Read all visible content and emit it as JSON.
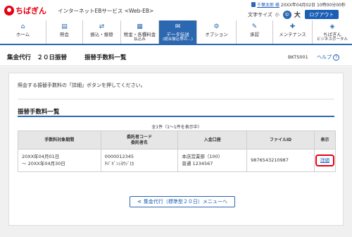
{
  "header": {
    "logo_text": "ちばぎん",
    "service_name": "インターネットEBサービス <Web-EB>",
    "user_name": "千葉太郎 様",
    "login_time": "20XX年04月02日 10時00分00秒",
    "font_size_label": "文字サイズ",
    "font_small": "小",
    "font_mid": "中",
    "font_large": "大",
    "logout_label": "ログアウト"
  },
  "nav": {
    "items": [
      {
        "label": "ホーム",
        "sub": "",
        "icon": "home-icon",
        "glyph": "⌂"
      },
      {
        "label": "照会",
        "sub": "",
        "icon": "document-icon",
        "glyph": "▤"
      },
      {
        "label": "振込・振替",
        "sub": "",
        "icon": "transfer-icon",
        "glyph": "⇄"
      },
      {
        "label": "税金・各種料金",
        "sub": "払込み",
        "icon": "tax-icon",
        "glyph": "▦"
      },
      {
        "label": "データ伝送",
        "sub": "(総合振込等の…)",
        "icon": "data-transfer-icon",
        "glyph": "✉"
      },
      {
        "label": "オプション",
        "sub": "",
        "icon": "gear-icon",
        "glyph": "⚙"
      },
      {
        "label": "承認",
        "sub": "",
        "icon": "approval-icon",
        "glyph": "✎"
      },
      {
        "label": "メンテナンス",
        "sub": "",
        "icon": "wrench-icon",
        "glyph": "✚"
      },
      {
        "label": "ちばぎん",
        "sub": "ビジネスポータル",
        "icon": "portal-icon",
        "glyph": "◈"
      }
    ]
  },
  "title": {
    "main": "集金代行　２０日振替",
    "sub": "振替手数料一覧",
    "screen_id": "BKTS001",
    "help": "ヘルプ",
    "help_glyph": "?"
  },
  "guide_text": "照会する振替手数料の「詳細」ボタンを押してください。",
  "section_title": "振替手数料一覧",
  "count_text": "全1件（1～1件を表示中）",
  "table": {
    "headers": [
      "手数料対象期間",
      "委託者コード\n委託者名",
      "入金口座",
      "ファイルID",
      "表示"
    ],
    "rows": [
      {
        "period_from": "20XX年04月01日",
        "period_to": "～ 20XX年04月30日",
        "code": "0000012345",
        "name": "ﾁﾊﾞｷﾞﾝｼﾖｳｼﾞ(ｶ",
        "branch": "本店営業部（100）",
        "account": "普通 1234567",
        "file_id": "9876543210987",
        "detail": "詳細"
      }
    ]
  },
  "back_button": "集金代行（標準型２０日）メニューへ",
  "colors": {
    "brand": "#e60012",
    "accent": "#2c67b1"
  }
}
